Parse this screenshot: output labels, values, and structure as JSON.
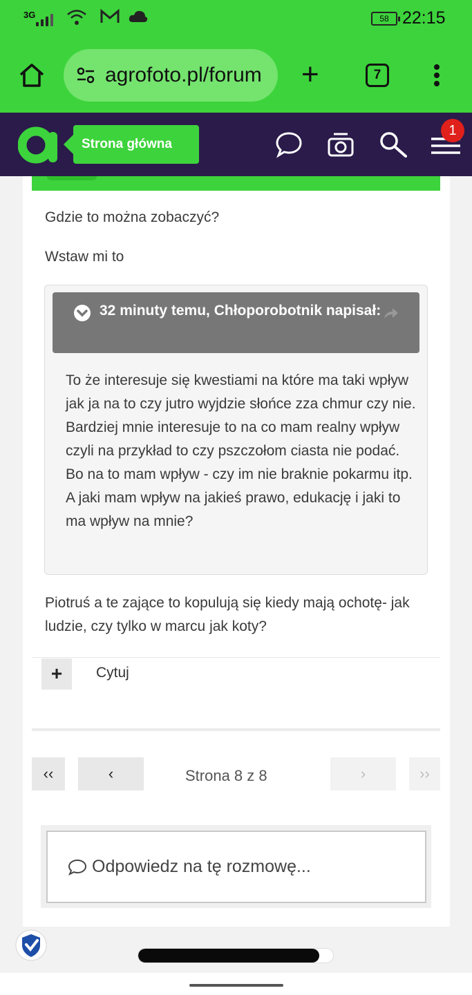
{
  "status_bar": {
    "network": "3G",
    "battery": "58",
    "time": "22:15",
    "icons": [
      "signal-icon",
      "wifi-icon",
      "gmail-icon",
      "cloud-icon",
      "battery-icon"
    ]
  },
  "browser": {
    "url": "agrofoto.pl/forum",
    "tab_count": "7",
    "icons": [
      "home-icon",
      "site-settings-icon",
      "new-tab-icon",
      "tabs-icon",
      "menu-dots-icon"
    ]
  },
  "site_header": {
    "home_label": "Strona główna",
    "notification_count": "1",
    "colors": {
      "green": "#3dd33c",
      "navy": "#2a1b4a"
    }
  },
  "post": {
    "paragraph1": "Gdzie to można zobaczyć?",
    "paragraph2": "Wstaw mi to",
    "quote": {
      "header": "32 minuty temu, Chłoporobotnik napisał:",
      "body": "To że interesuje się kwestiami na które ma taki wpływ jak ja na to czy jutro wyjdzie słońce zza chmur czy nie. Bardziej mnie interesuje to na co mam realny wpływ czyli na przykład to czy pszczołom ciasta nie podać. Bo na to mam wpływ - czy im nie braknie pokarmu itp. A jaki mam wpływ na jakieś prawo, edukację i jaki to ma wpływ na mnie?"
    },
    "paragraph3": "Piotruś a te zające to kopulują się kiedy mają ochotę- jak ludzie, czy tylko w marcu jak koty?",
    "quote_action": {
      "plus": "+",
      "label": "Cytuj"
    }
  },
  "pagination": {
    "first": "‹‹",
    "prev": "‹",
    "info": "Strona 8 z 8",
    "next": "›",
    "last": "››"
  },
  "reply": {
    "placeholder": "Odpowiedz na tę rozmowę..."
  },
  "page_load_progress": 0.93
}
